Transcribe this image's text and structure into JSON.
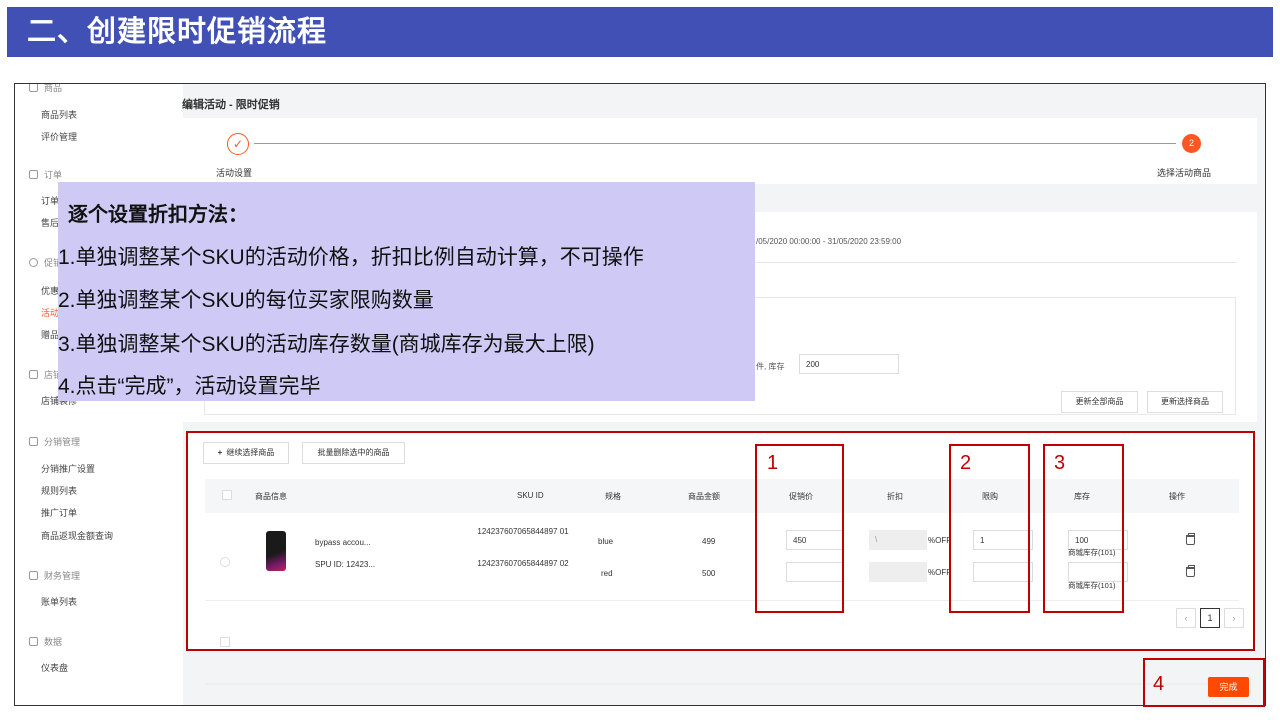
{
  "banner": {
    "title": "二、创建限时促销流程"
  },
  "sidebar": {
    "top_cut": "商品",
    "items": [
      {
        "label": "商品列表",
        "type": "item"
      },
      {
        "label": "评价管理",
        "type": "item"
      },
      {
        "label": "订单",
        "type": "header"
      },
      {
        "label": "订单",
        "type": "item"
      },
      {
        "label": "售后",
        "type": "item"
      },
      {
        "label": "促销",
        "type": "header"
      },
      {
        "label": "优惠",
        "type": "item"
      },
      {
        "label": "活动",
        "type": "item"
      },
      {
        "label": "赠品",
        "type": "item"
      },
      {
        "label": "店铺",
        "type": "header"
      },
      {
        "label": "店铺装修",
        "type": "item"
      },
      {
        "label": "分销管理",
        "type": "header"
      },
      {
        "label": "分销推广设置",
        "type": "item"
      },
      {
        "label": "规则列表",
        "type": "item"
      },
      {
        "label": "推广订单",
        "type": "item"
      },
      {
        "label": "商品返现金额查询",
        "type": "item"
      },
      {
        "label": "财务管理",
        "type": "header"
      },
      {
        "label": "账单列表",
        "type": "item"
      },
      {
        "label": "数据",
        "type": "header"
      },
      {
        "label": "仪表盘",
        "type": "item"
      }
    ]
  },
  "page": {
    "title": "编辑活动 - 限时促销"
  },
  "steps": {
    "step1_label": "活动设置",
    "step2_number": "2",
    "step2_label": "选择活动商品"
  },
  "settings": {
    "date_range": "/05/2020 00:00:00 - 31/05/2020 23:59:00",
    "stock_label": "件, 库存",
    "stock_value": "200",
    "update_all_label": "更新全部商品",
    "update_selected_label": "更新选择商品"
  },
  "products": {
    "continue_label": "继续选择商品",
    "batch_delete_label": "批量删除选中的商品",
    "columns": {
      "info": "商品信息",
      "sku": "SKU ID",
      "spec": "规格",
      "amount": "商品金额",
      "promo": "促销价",
      "discount": "折扣",
      "limit": "限购",
      "stock": "库存",
      "ops": "操作"
    },
    "product_name": "bypass accou...",
    "spu": "SPU ID: 12423...",
    "rows": [
      {
        "sku": "124237607065844897 01",
        "spec": "blue",
        "amount": "499",
        "promo": "450",
        "discount": "\\",
        "pct": "%OFF",
        "limit": "1",
        "stock": "100",
        "mall_stock": "商城库存(101)"
      },
      {
        "sku": "124237607065844897 02",
        "spec": "red",
        "amount": "500",
        "promo": "",
        "discount": "",
        "pct": "%OFF",
        "limit": "",
        "stock": "",
        "mall_stock": "商城库存(101)"
      }
    ],
    "page_number": "1"
  },
  "overlay": {
    "title": "逐个设置折扣方法：",
    "lines": [
      "1.单独调整某个SKU的活动价格，折扣比例自动计算，不可操作",
      "2.单独调整某个SKU的每位买家限购数量",
      "3.单独调整某个SKU的活动库存数量(商城库存为最大上限)",
      "4.点击“完成”，活动设置完毕"
    ]
  },
  "annotations": {
    "n1": "1",
    "n2": "2",
    "n3": "3",
    "n4": "4"
  },
  "footer": {
    "done_label": "完成"
  }
}
